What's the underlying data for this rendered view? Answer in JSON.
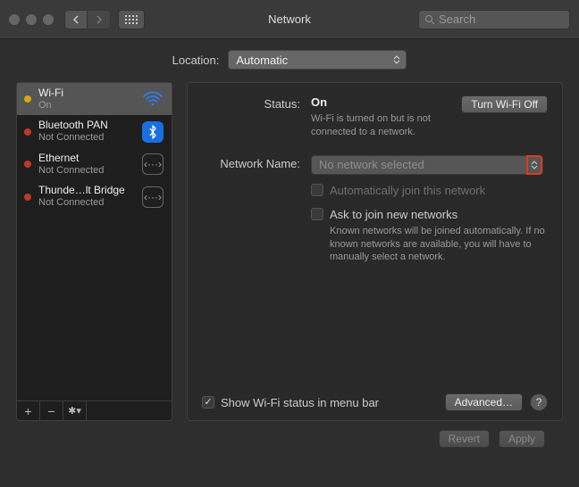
{
  "window": {
    "title": "Network"
  },
  "search": {
    "placeholder": "Search"
  },
  "location": {
    "label": "Location:",
    "value": "Automatic"
  },
  "sidebar": {
    "items": [
      {
        "name": "Wi-Fi",
        "sub": "On",
        "status": "yellow",
        "icon": "wifi"
      },
      {
        "name": "Bluetooth PAN",
        "sub": "Not Connected",
        "status": "red",
        "icon": "bluetooth"
      },
      {
        "name": "Ethernet",
        "sub": "Not Connected",
        "status": "red",
        "icon": "ethernet"
      },
      {
        "name": "Thunde…lt Bridge",
        "sub": "Not Connected",
        "status": "red",
        "icon": "thunderbolt"
      }
    ]
  },
  "detail": {
    "status_label": "Status:",
    "status_value": "On",
    "toggle_btn": "Turn Wi-Fi Off",
    "status_sub": "Wi-Fi is turned on but is not connected to a network.",
    "network_label": "Network Name:",
    "network_placeholder": "No network selected",
    "auto_join": "Automatically join this network",
    "ask_join": "Ask to join new networks",
    "ask_sub": "Known networks will be joined automatically. If no known networks are available, you will have to manually select a network.",
    "show_status": "Show Wi-Fi status in menu bar",
    "advanced": "Advanced…"
  },
  "footer": {
    "revert": "Revert",
    "apply": "Apply"
  }
}
